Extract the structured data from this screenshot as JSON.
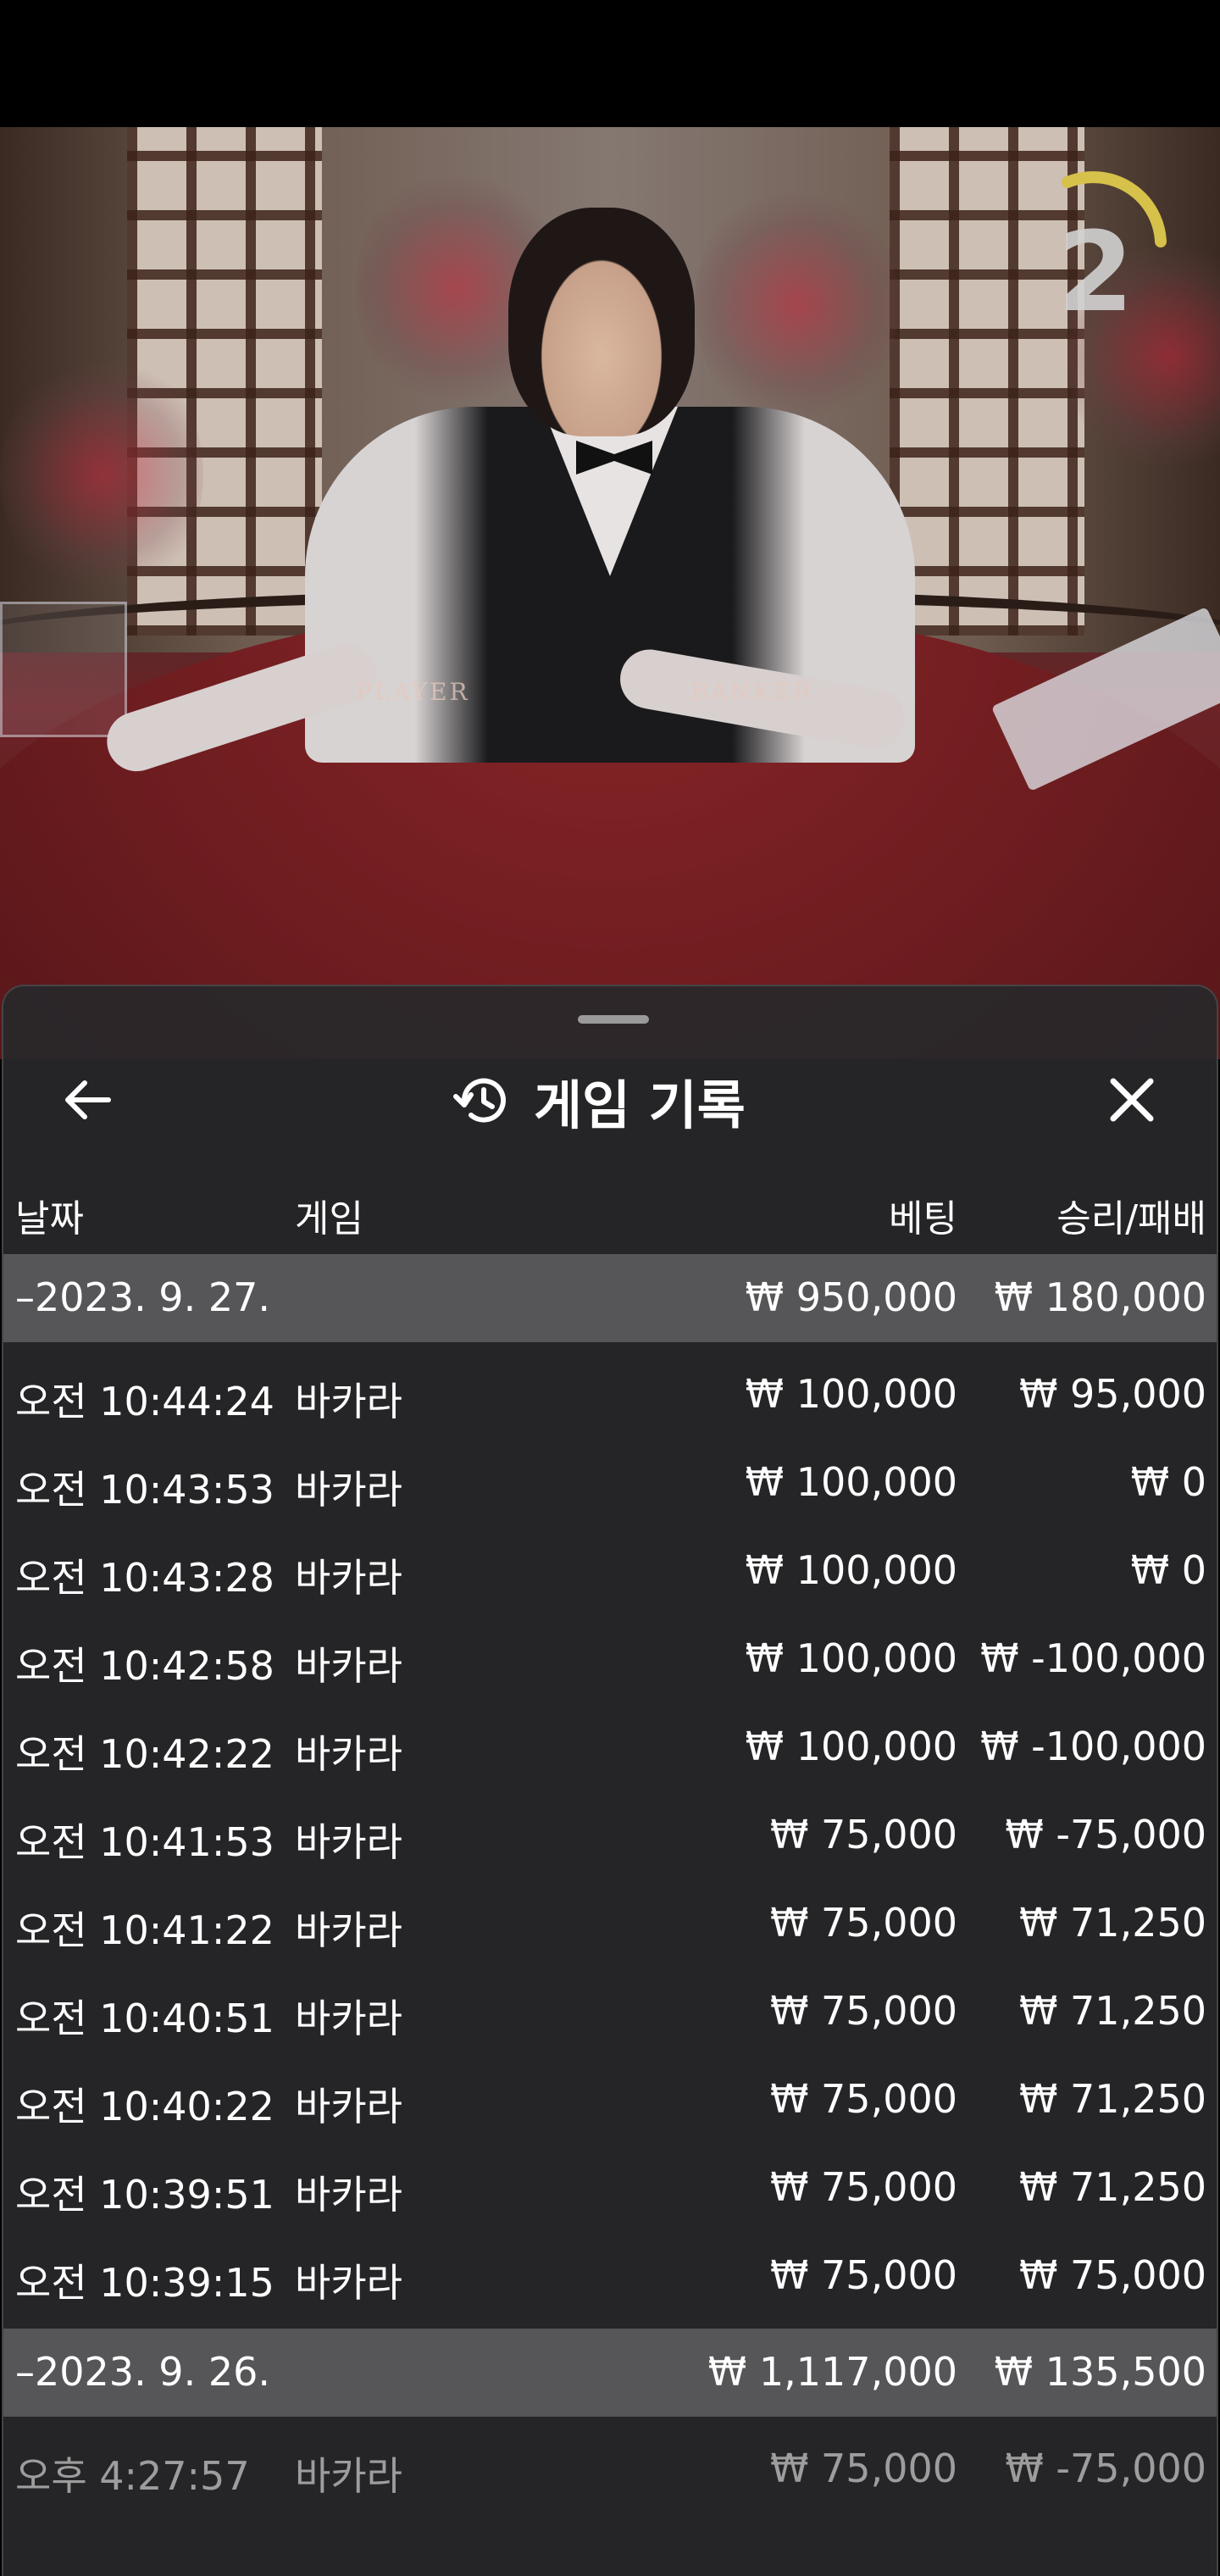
{
  "dealer_video": {
    "table_labels": {
      "player": "PLAYER",
      "banker": "BANKER"
    },
    "countdown": {
      "value": "2",
      "accent_color": "#d6c14a"
    }
  },
  "sheet": {
    "title": "게임 기록",
    "back_icon": "arrow-left-icon",
    "history_icon": "history-clock-icon",
    "close_icon": "close-x-icon"
  },
  "columns": {
    "date": "날짜",
    "game": "게임",
    "bet": "베팅",
    "winloss": "승리/패배"
  },
  "groups": [
    {
      "date": "–2023. 9. 27.",
      "total_bet": "₩ 950,000",
      "total_winloss": "₩ 180,000",
      "rows": [
        {
          "time": "오전 10:44:24",
          "game": "바카라",
          "bet": "₩ 100,000",
          "winloss": "₩ 95,000"
        },
        {
          "time": "오전 10:43:53",
          "game": "바카라",
          "bet": "₩ 100,000",
          "winloss": "₩ 0"
        },
        {
          "time": "오전 10:43:28",
          "game": "바카라",
          "bet": "₩ 100,000",
          "winloss": "₩ 0"
        },
        {
          "time": "오전 10:42:58",
          "game": "바카라",
          "bet": "₩ 100,000",
          "winloss": "₩ -100,000"
        },
        {
          "time": "오전 10:42:22",
          "game": "바카라",
          "bet": "₩ 100,000",
          "winloss": "₩ -100,000"
        },
        {
          "time": "오전 10:41:53",
          "game": "바카라",
          "bet": "₩ 75,000",
          "winloss": "₩ -75,000"
        },
        {
          "time": "오전 10:41:22",
          "game": "바카라",
          "bet": "₩ 75,000",
          "winloss": "₩ 71,250"
        },
        {
          "time": "오전 10:40:51",
          "game": "바카라",
          "bet": "₩ 75,000",
          "winloss": "₩ 71,250"
        },
        {
          "time": "오전 10:40:22",
          "game": "바카라",
          "bet": "₩ 75,000",
          "winloss": "₩ 71,250"
        },
        {
          "time": "오전 10:39:51",
          "game": "바카라",
          "bet": "₩ 75,000",
          "winloss": "₩ 71,250"
        },
        {
          "time": "오전 10:39:15",
          "game": "바카라",
          "bet": "₩ 75,000",
          "winloss": "₩ 75,000"
        }
      ]
    },
    {
      "date": "–2023. 9. 26.",
      "total_bet": "₩ 1,117,000",
      "total_winloss": "₩ 135,500",
      "rows": [
        {
          "time": "오후 4:27:57",
          "game": "바카라",
          "bet": "₩ 75,000",
          "winloss": "₩ -75,000"
        }
      ]
    }
  ]
}
